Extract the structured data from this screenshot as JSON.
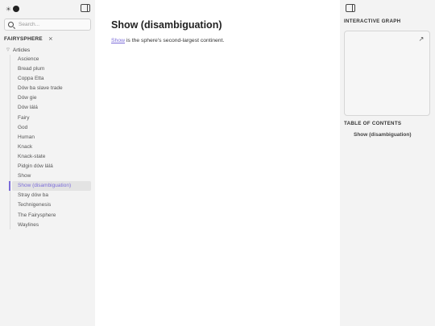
{
  "left_sidebar": {
    "search": {
      "placeholder": "Search...",
      "value": ""
    },
    "vault_name": "FAIRYSPHERE",
    "folder": "Articles",
    "items": [
      {
        "label": "Ascience"
      },
      {
        "label": "Bread plum"
      },
      {
        "label": "Coppa Etta"
      },
      {
        "label": "Dów ba slave trade"
      },
      {
        "label": "Dów gie"
      },
      {
        "label": "Dów lálá"
      },
      {
        "label": "Fairy"
      },
      {
        "label": "God"
      },
      {
        "label": "Human"
      },
      {
        "label": "Knack"
      },
      {
        "label": "Knack-state"
      },
      {
        "label": "Pidgin dów lálá"
      },
      {
        "label": "Show"
      },
      {
        "label": "Show (disambiguation)",
        "active": true
      },
      {
        "label": "Stray dów ba"
      },
      {
        "label": "Technigenesis"
      },
      {
        "label": "The Fairysphere"
      },
      {
        "label": "Waylines"
      }
    ]
  },
  "main": {
    "title": "Show (disambiguation)",
    "body_link": "Show",
    "body_rest": " is the sphere's second-largest continent."
  },
  "right_sidebar": {
    "graph_title": "INTERACTIVE GRAPH",
    "toc_title": "TABLE OF CONTENTS",
    "toc_items": [
      "Show (disambiguation)"
    ]
  },
  "colors": {
    "accent": "#7b6cd9",
    "sidebar_bg": "#f3f3f3",
    "main_bg": "#ffffff"
  }
}
